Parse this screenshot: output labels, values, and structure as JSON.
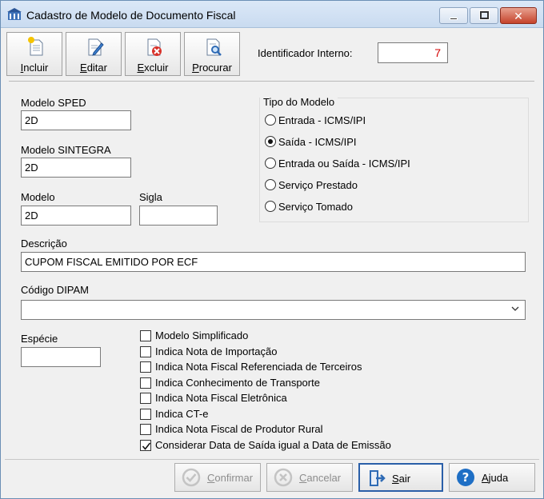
{
  "window": {
    "title": "Cadastro de Modelo de Documento Fiscal",
    "controls": {
      "minimize": "minimize",
      "maximize": "maximize",
      "close": "✕"
    }
  },
  "toolbar": {
    "buttons": [
      {
        "label": "Incluir",
        "icon": "new-document-icon"
      },
      {
        "label": "Editar",
        "icon": "edit-document-icon"
      },
      {
        "label": "Excluir",
        "icon": "delete-document-icon"
      },
      {
        "label": "Procurar",
        "icon": "search-document-icon"
      }
    ],
    "identificador_label": "Identificador Interno:",
    "identificador_value": "7"
  },
  "form": {
    "modelo_sped": {
      "label": "Modelo SPED",
      "value": "2D"
    },
    "modelo_sintegra": {
      "label": "Modelo SINTEGRA",
      "value": "2D"
    },
    "modelo": {
      "label": "Modelo",
      "value": "2D"
    },
    "sigla": {
      "label": "Sigla",
      "value": ""
    },
    "descricao": {
      "label": "Descrição",
      "value": "CUPOM FISCAL EMITIDO POR ECF"
    },
    "codigo_dipam": {
      "label": "Código DIPAM",
      "value": ""
    },
    "especie": {
      "label": "Espécie",
      "value": ""
    },
    "tipo_modelo": {
      "title": "Tipo do Modelo",
      "options": [
        {
          "label": "Entrada - ICMS/IPI",
          "selected": false
        },
        {
          "label": "Saída - ICMS/IPI",
          "selected": true
        },
        {
          "label": "Entrada ou Saída - ICMS/IPI",
          "selected": false
        },
        {
          "label": "Serviço Prestado",
          "selected": false
        },
        {
          "label": "Serviço Tomado",
          "selected": false
        }
      ]
    },
    "checkboxes": [
      {
        "label": "Modelo Simplificado",
        "checked": false
      },
      {
        "label": "Indica Nota de Importação",
        "checked": false
      },
      {
        "label": "Indica Nota Fiscal Referenciada de Terceiros",
        "checked": false
      },
      {
        "label": "Indica Conhecimento de Transporte",
        "checked": false
      },
      {
        "label": "Indica Nota Fiscal Eletrônica",
        "checked": false
      },
      {
        "label": "Indica CT-e",
        "checked": false
      },
      {
        "label": "Indica Nota Fiscal de Produtor Rural",
        "checked": false
      },
      {
        "label": "Considerar Data de Saída igual a Data de Emissão",
        "checked": true
      }
    ]
  },
  "footer": {
    "confirmar": {
      "label": "Confirmar",
      "enabled": false
    },
    "cancelar": {
      "label": "Cancelar",
      "enabled": false
    },
    "sair": {
      "label": "Sair",
      "enabled": true
    },
    "ajuda": {
      "label": "Ajuda",
      "enabled": true
    }
  },
  "colors": {
    "id_value": "#d40000",
    "titlebar": "#c9dbf0",
    "help_blue": "#1f6fc5"
  }
}
